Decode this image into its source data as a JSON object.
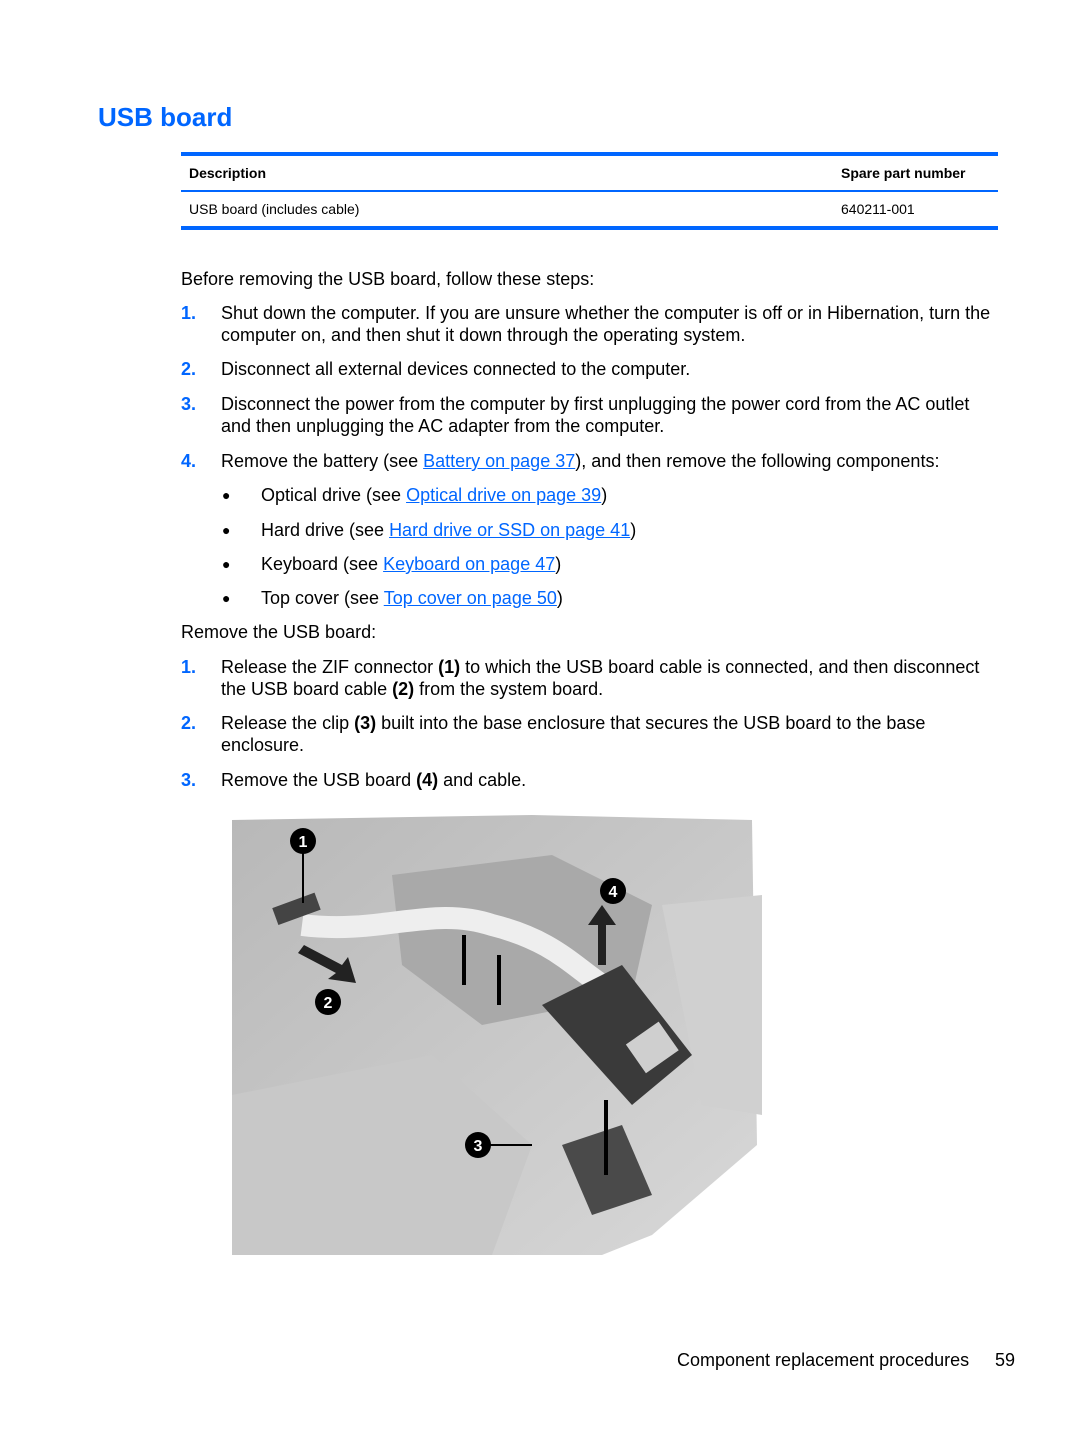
{
  "title": "USB board",
  "table": {
    "headers": [
      "Description",
      "Spare part number"
    ],
    "rows": [
      [
        "USB board (includes cable)",
        "640211-001"
      ]
    ]
  },
  "intro": "Before removing the USB board, follow these steps:",
  "prep_steps": [
    {
      "n": "1.",
      "text": "Shut down the computer. If you are unsure whether the computer is off or in Hibernation, turn the computer on, and then shut it down through the operating system."
    },
    {
      "n": "2.",
      "text": "Disconnect all external devices connected to the computer."
    },
    {
      "n": "3.",
      "text": "Disconnect the power from the computer by first unplugging the power cord from the AC outlet and then unplugging the AC adapter from the computer."
    },
    {
      "n": "4.",
      "pre": "Remove the battery (see ",
      "link": "Battery on page 37",
      "post": "), and then remove the following components:"
    }
  ],
  "components": [
    {
      "pre": "Optical drive (see ",
      "link": "Optical drive on page 39",
      "post": ")"
    },
    {
      "pre": "Hard drive (see ",
      "link": "Hard drive or SSD on page 41",
      "post": ")"
    },
    {
      "pre": "Keyboard (see ",
      "link": "Keyboard on page 47",
      "post": ")"
    },
    {
      "pre": "Top cover (see ",
      "link": "Top cover on page 50",
      "post": ")"
    }
  ],
  "bullet": "●",
  "remove_intro": "Remove the USB board:",
  "remove_steps": [
    {
      "n": "1.",
      "a": "Release the ZIF connector ",
      "b1": "(1)",
      "c": " to which the USB board cable is connected, and then disconnect the USB board cable ",
      "b2": "(2)",
      "d": " from the system board."
    },
    {
      "n": "2.",
      "a": "Release the clip ",
      "b1": "(3)",
      "c": " built into the base enclosure that secures the USB board to the base enclosure."
    },
    {
      "n": "3.",
      "a": "Remove the USB board ",
      "b1": "(4)",
      "c": " and cable."
    }
  ],
  "figure": {
    "callouts": [
      "1",
      "2",
      "3",
      "4"
    ]
  },
  "footer": {
    "section": "Component replacement procedures",
    "page": "59"
  },
  "colors": {
    "accent": "#0066ff"
  }
}
